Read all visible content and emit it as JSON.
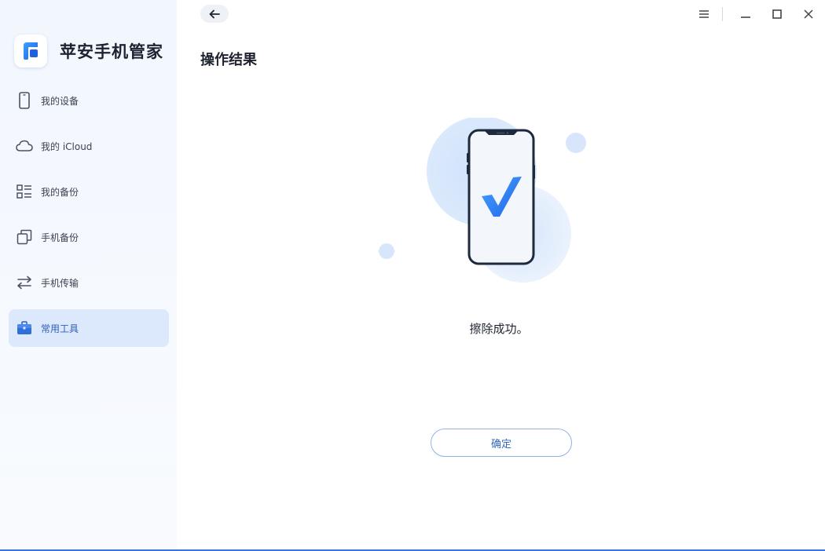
{
  "app": {
    "name": "苹安手机管家"
  },
  "sidebar": {
    "items": [
      {
        "label": "我的设备",
        "icon": "phone-icon",
        "active": false
      },
      {
        "label": "我的 iCloud",
        "icon": "cloud-icon",
        "active": false
      },
      {
        "label": "我的备份",
        "icon": "list-icon",
        "active": false
      },
      {
        "label": "手机备份",
        "icon": "copy-icon",
        "active": false
      },
      {
        "label": "手机传输",
        "icon": "transfer-icon",
        "active": false
      },
      {
        "label": "常用工具",
        "icon": "toolbox-icon",
        "active": true
      }
    ]
  },
  "main": {
    "title": "操作结果",
    "result_message": "擦除成功。",
    "confirm_label": "确定"
  },
  "colors": {
    "accent": "#3567c0",
    "active_bg": "#dce8fb",
    "check_blue": "#2f7cf6"
  }
}
